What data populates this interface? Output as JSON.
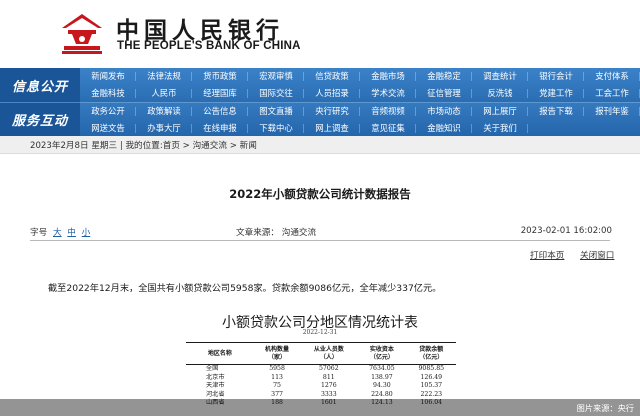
{
  "header": {
    "brand_cn": "中国人民银行",
    "brand_en": "THE PEOPLE'S BANK OF CHINA",
    "emblem_color": "#c8161d"
  },
  "nav": {
    "info_label": "信息公开",
    "service_label": "服务互动",
    "info_items": [
      "新闻发布",
      "法律法规",
      "货币政策",
      "宏观审慎",
      "信贷政策",
      "金融市场",
      "金融稳定",
      "调查统计",
      "银行会计",
      "支付体系",
      "金融科技",
      "人民币",
      "经理国库",
      "国际交往",
      "人员招录",
      "学术交流",
      "征信管理",
      "反洗钱",
      "党建工作",
      "工会工作"
    ],
    "service_items": [
      "政务公开",
      "政策解读",
      "公告信息",
      "图文直播",
      "央行研究",
      "音频视频",
      "市场动态",
      "网上展厅",
      "报告下载",
      "报刊年鉴",
      "网送文告",
      "办事大厅",
      "在线申报",
      "下载中心",
      "网上调查",
      "意见征集",
      "金融知识",
      "关于我们"
    ],
    "bar_color": "#1d5fa3"
  },
  "breadcrumb": {
    "text": "2023年2月8日  星期三 | 我的位置:首页 > 沟通交流 > 新闻"
  },
  "article": {
    "title": "2022年小额贷款公司统计数据报告",
    "font_size_label": "字号",
    "font_sizes": [
      "大",
      "中",
      "小"
    ],
    "source_label": "文章来源：",
    "source": "沟通交流",
    "date": "2023-02-01 16:02:00",
    "print_label": "打印本页",
    "close_label": "关闭窗口",
    "body": "截至2022年12月末，全国共有小额贷款公司5958家。贷款余额9086亿元，全年减少337亿元。"
  },
  "table_image": {
    "title": "小额贷款公司分地区情况统计表",
    "date": "2022-12-31",
    "headers": [
      "地区名称",
      "机构数量\n（家）",
      "从业人员数\n（人）",
      "实收资本\n（亿元）",
      "贷款余额\n（亿元）"
    ],
    "rows": [
      [
        "全国",
        "5958",
        "57062",
        "7634.05",
        "9085.85"
      ],
      [
        "北京市",
        "113",
        "811",
        "138.97",
        "126.49"
      ],
      [
        "天津市",
        "75",
        "1276",
        "94.30",
        "105.37"
      ],
      [
        "河北省",
        "377",
        "3333",
        "224.80",
        "222.23"
      ],
      [
        "山西省",
        "188",
        "1601",
        "124.13",
        "106.04"
      ]
    ]
  },
  "photo_credit": "图片来源：央行"
}
